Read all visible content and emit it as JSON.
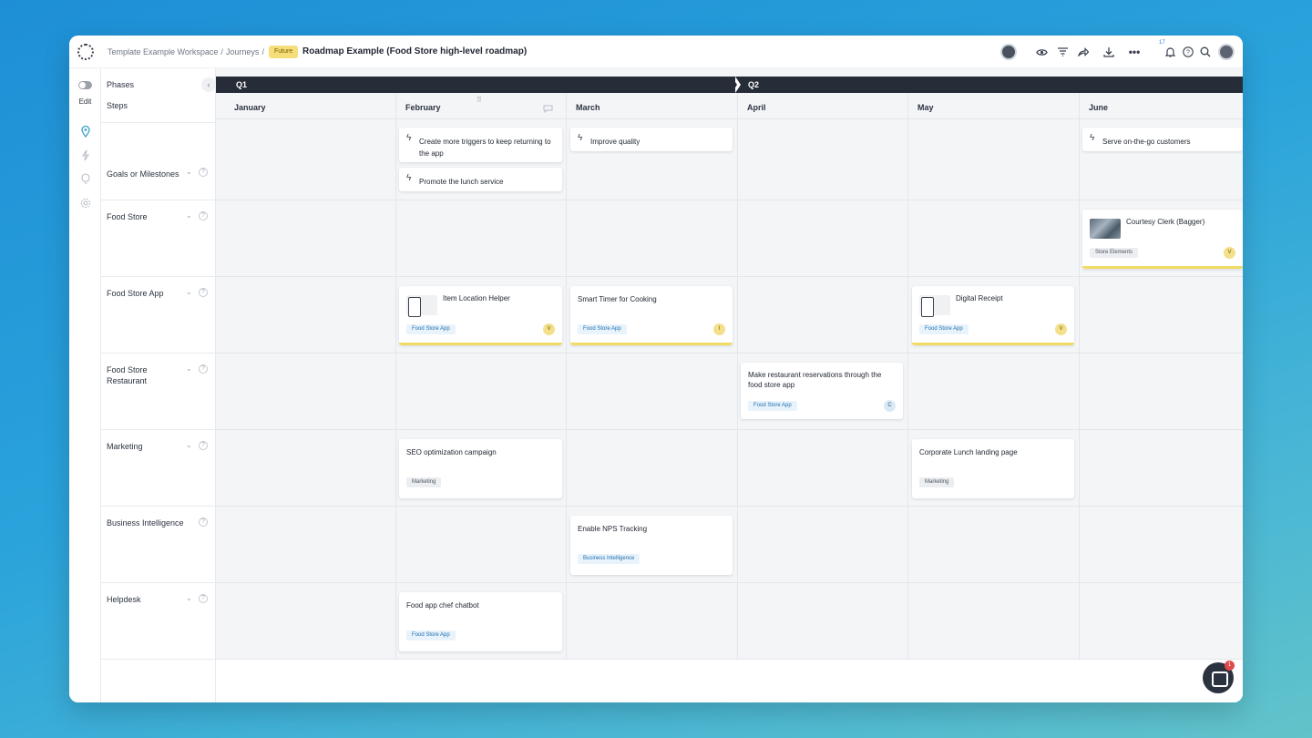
{
  "header": {
    "breadcrumb_workspace": "Template Example Workspace",
    "breadcrumb_sep1": "/",
    "breadcrumb_journeys": "Journeys",
    "breadcrumb_sep2": "/",
    "status_badge": "Future",
    "title": "Roadmap Example (Food Store high-level roadmap)",
    "notification_count": "17"
  },
  "rail": {
    "edit_label": "Edit"
  },
  "labels": {
    "phases": "Phases",
    "steps": "Steps",
    "rows": [
      "Goals or Milestones",
      "Food Store",
      "Food Store App",
      "Food Store Restaurant",
      "Marketing",
      "Business Intelligence",
      "Helpdesk"
    ]
  },
  "timeline": {
    "quarters": [
      "Q1",
      "Q2"
    ],
    "months": [
      "January",
      "February",
      "March",
      "April",
      "May",
      "June"
    ]
  },
  "goals": [
    {
      "title": "Create more triggers to keep returning to the app"
    },
    {
      "title": "Promote the lunch service"
    },
    {
      "title": "Improve quality"
    },
    {
      "title": "Serve on-the-go customers"
    }
  ],
  "cards": [
    {
      "title": "Courtesy Clerk (Bagger)",
      "tag": "Store Elements",
      "avatar": "V"
    },
    {
      "title": "Item Location Helper",
      "tag": "Food Store App",
      "avatar": "V"
    },
    {
      "title": "Smart Timer for Cooking",
      "tag": "Food Store App",
      "avatar": "I"
    },
    {
      "title": "Digital Receipt",
      "tag": "Food Store App",
      "avatar": "V"
    },
    {
      "title": "Make restaurant reservations through the food store app",
      "tag": "Food Store App",
      "avatar": "C"
    },
    {
      "title": "SEO optimization campaign",
      "tag": "Marketing"
    },
    {
      "title": "Corporate Lunch landing page",
      "tag": "Marketing"
    },
    {
      "title": "Enable NPS Tracking",
      "tag": "Business Intelligence"
    },
    {
      "title": "Food app chef chatbot",
      "tag": "Food Store App"
    }
  ],
  "chat": {
    "count": "1"
  },
  "colors": {
    "accent_yellow": "#f2db62",
    "dark_bar": "#272d38",
    "tag_blue": "#1f6fb0"
  }
}
